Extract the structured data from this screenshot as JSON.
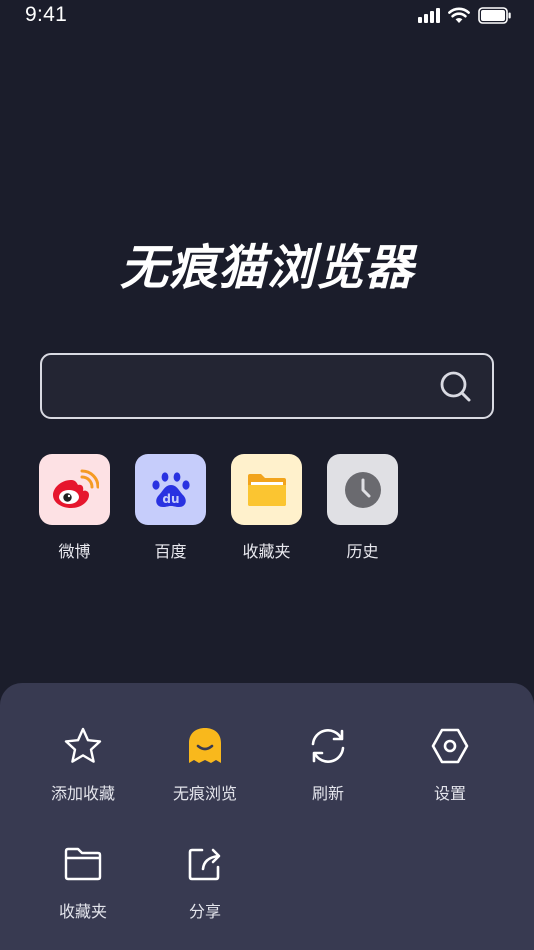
{
  "status_bar": {
    "time": "9:41"
  },
  "app": {
    "title": "无痕猫浏览器"
  },
  "search": {
    "placeholder": ""
  },
  "shortcuts": [
    {
      "label": "微博",
      "icon": "weibo-icon",
      "bg": "#fde1e4"
    },
    {
      "label": "百度",
      "icon": "baidu-paw-icon",
      "bg": "#c6cdfb"
    },
    {
      "label": "收藏夹",
      "icon": "folder-icon",
      "bg": "#fff1cc"
    },
    {
      "label": "历史",
      "icon": "clock-icon",
      "bg": "#e0e0e4"
    }
  ],
  "menu": {
    "items": [
      {
        "label": "添加收藏",
        "icon": "star-icon"
      },
      {
        "label": "无痕浏览",
        "icon": "ghost-icon"
      },
      {
        "label": "刷新",
        "icon": "refresh-icon"
      },
      {
        "label": "设置",
        "icon": "settings-hexagon-icon"
      },
      {
        "label": "收藏夹",
        "icon": "folder-outline-icon"
      },
      {
        "label": "分享",
        "icon": "share-icon"
      }
    ]
  },
  "colors": {
    "background": "#1b1d2b",
    "sheet": "#383a51",
    "ghost_accent": "#f9b81c",
    "baidu_blue": "#2932e1",
    "weibo_red": "#e6162d"
  }
}
